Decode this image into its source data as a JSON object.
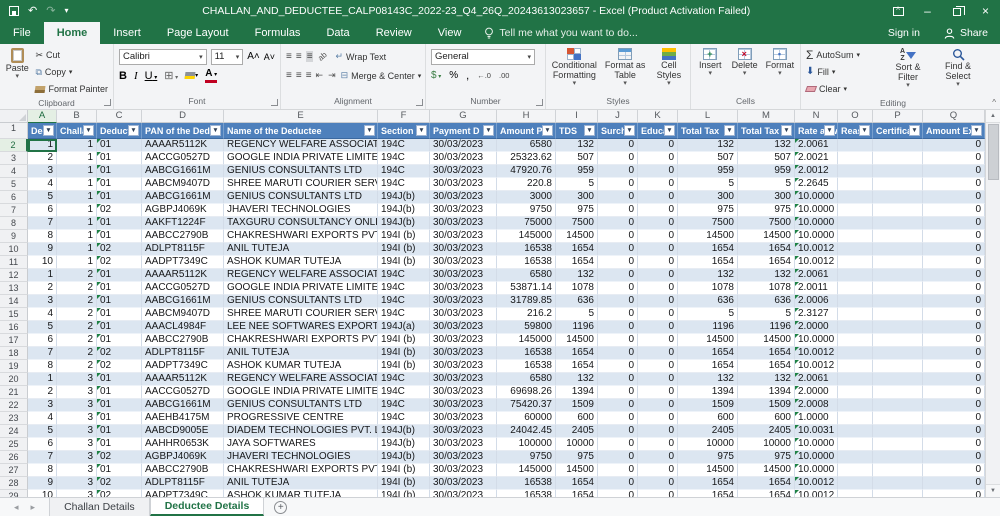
{
  "colors": {
    "excel_green": "#217346",
    "table_header_blue": "#4e80bc",
    "band_blue": "#dce6f1",
    "error_triangle_green": "#1e8245"
  },
  "title_bar": {
    "title": "CHALLAN_AND_DEDUCTEE_CALP08143C_2022-23_Q4_26Q_20243613023657 - Excel (Product Activation Failed)"
  },
  "menu": {
    "tabs": [
      "File",
      "Home",
      "Insert",
      "Page Layout",
      "Formulas",
      "Data",
      "Review",
      "View"
    ],
    "active_tab": "Home",
    "tell_me": "Tell me what you want to do...",
    "sign_in": "Sign in",
    "share": "Share"
  },
  "ribbon": {
    "clipboard": {
      "label": "Clipboard",
      "paste": "Paste",
      "cut": "Cut",
      "copy": "Copy",
      "format_painter": "Format Painter"
    },
    "font": {
      "label": "Font",
      "family": "Calibri",
      "size": "11",
      "bold": "B",
      "italic": "I",
      "underline": "U"
    },
    "alignment": {
      "label": "Alignment",
      "wrap_text": "Wrap Text",
      "merge_center": "Merge & Center"
    },
    "number": {
      "label": "Number",
      "format": "General",
      "percent": "%",
      "comma": ",",
      "inc_dec": "←.0",
      "dec_dec": ".00"
    },
    "styles": {
      "label": "Styles",
      "conditional": "Conditional Formatting",
      "format_table": "Format as Table",
      "cell_styles": "Cell Styles"
    },
    "cells": {
      "label": "Cells",
      "insert": "Insert",
      "delete": "Delete",
      "format": "Format"
    },
    "editing": {
      "label": "Editing",
      "autosum": "AutoSum",
      "fill": "Fill",
      "clear": "Clear",
      "sort_filter": "Sort & Filter",
      "find_select": "Find & Select"
    }
  },
  "icons": {
    "dropdown_arrow": "▾",
    "sigma": "Σ",
    "scissors": "✂",
    "copy": "⧉",
    "bulb": "☼",
    "collapse": "^"
  },
  "grid": {
    "first_row_number": 1,
    "first_data_row_number": 2,
    "active_cell": "A2",
    "columns": [
      {
        "letter": "A",
        "width": 29,
        "header": "Dedu",
        "align": "r",
        "flag": false
      },
      {
        "letter": "B",
        "width": 40,
        "header": "Challan",
        "align": "r",
        "flag": false
      },
      {
        "letter": "C",
        "width": 45,
        "header": "Deducte",
        "align": "l",
        "flag": true
      },
      {
        "letter": "D",
        "width": 82,
        "header": "PAN of the Ded",
        "align": "l",
        "flag": false
      },
      {
        "letter": "E",
        "width": 154,
        "header": "Name of the Deductee",
        "align": "l",
        "flag": false
      },
      {
        "letter": "F",
        "width": 52,
        "header": "Section C",
        "align": "l",
        "flag": false
      },
      {
        "letter": "G",
        "width": 67,
        "header": "Payment D",
        "align": "l",
        "flag": false
      },
      {
        "letter": "H",
        "width": 59,
        "header": "Amount Pa",
        "align": "r",
        "flag": false
      },
      {
        "letter": "I",
        "width": 42,
        "header": "TDS",
        "align": "r",
        "flag": false
      },
      {
        "letter": "J",
        "width": 40,
        "header": "Surchar",
        "align": "r",
        "flag": false
      },
      {
        "letter": "K",
        "width": 40,
        "header": "Educati",
        "align": "r",
        "flag": false
      },
      {
        "letter": "L",
        "width": 60,
        "header": "Total Tax",
        "align": "r",
        "flag": false
      },
      {
        "letter": "M",
        "width": 57,
        "header": "Total Tax",
        "align": "r",
        "flag": false
      },
      {
        "letter": "N",
        "width": 43,
        "header": "Rate at w",
        "align": "l",
        "flag": true
      },
      {
        "letter": "O",
        "width": 35,
        "header": "Reaso",
        "align": "l",
        "flag": false
      },
      {
        "letter": "P",
        "width": 50,
        "header": "Certificat",
        "align": "l",
        "flag": false
      },
      {
        "letter": "Q",
        "width": 62,
        "header": "Amount Ex",
        "align": "r",
        "flag": false
      }
    ],
    "rows": [
      [
        "1",
        "1",
        "01",
        "AAAAR5112K",
        "REGENCY WELFARE ASSOCIATION",
        "194C",
        "30/03/2023",
        "6580",
        "132",
        "0",
        "0",
        "132",
        "132",
        "2.0061",
        "",
        "",
        "0"
      ],
      [
        "2",
        "1",
        "01",
        "AACCG0527D",
        "GOOGLE INDIA PRIVATE LIMITED",
        "194C",
        "30/03/2023",
        "25323.62",
        "507",
        "0",
        "0",
        "507",
        "507",
        "2.0021",
        "",
        "",
        "0"
      ],
      [
        "3",
        "1",
        "01",
        "AABCG1661M",
        "GENIUS CONSULTANTS LTD",
        "194C",
        "30/03/2023",
        "47920.76",
        "959",
        "0",
        "0",
        "959",
        "959",
        "2.0012",
        "",
        "",
        "0"
      ],
      [
        "4",
        "1",
        "01",
        "AABCM9407D",
        "SHREE MARUTI COURIER SERVICES PVT",
        "194C",
        "30/03/2023",
        "220.8",
        "5",
        "0",
        "0",
        "5",
        "5",
        "2.2645",
        "",
        "",
        "0"
      ],
      [
        "5",
        "1",
        "01",
        "AABCG1661M",
        "GENIUS CONSULTANTS LTD",
        "194J(b)",
        "30/03/2023",
        "3000",
        "300",
        "0",
        "0",
        "300",
        "300",
        "10.0000",
        "",
        "",
        "0"
      ],
      [
        "6",
        "1",
        "02",
        "AGBPJ4069K",
        "JHAVERI TECHNOLOGIES",
        "194J(b)",
        "30/03/2023",
        "9750",
        "975",
        "0",
        "0",
        "975",
        "975",
        "10.0000",
        "",
        "",
        "0"
      ],
      [
        "7",
        "1",
        "01",
        "AAKFT1224F",
        "TAXGURU CONSULTANCY  ONLINE PUBL",
        "194J(b)",
        "30/03/2023",
        "75000",
        "7500",
        "0",
        "0",
        "7500",
        "7500",
        "10.0000",
        "",
        "",
        "0"
      ],
      [
        "8",
        "1",
        "01",
        "AABCC2790B",
        "CHAKRESHWARI EXPORTS PVT. LTD.",
        "194I (b)",
        "30/03/2023",
        "145000",
        "14500",
        "0",
        "0",
        "14500",
        "14500",
        "10.0000",
        "",
        "",
        "0"
      ],
      [
        "9",
        "1",
        "02",
        "ADLPT8115F",
        "ANIL TUTEJA",
        "194I (b)",
        "30/03/2023",
        "16538",
        "1654",
        "0",
        "0",
        "1654",
        "1654",
        "10.0012",
        "",
        "",
        "0"
      ],
      [
        "10",
        "1",
        "02",
        "AADPT7349C",
        "ASHOK KUMAR TUTEJA",
        "194I (b)",
        "30/03/2023",
        "16538",
        "1654",
        "0",
        "0",
        "1654",
        "1654",
        "10.0012",
        "",
        "",
        "0"
      ],
      [
        "1",
        "2",
        "01",
        "AAAAR5112K",
        "REGENCY WELFARE ASSOCIATION",
        "194C",
        "30/03/2023",
        "6580",
        "132",
        "0",
        "0",
        "132",
        "132",
        "2.0061",
        "",
        "",
        "0"
      ],
      [
        "2",
        "2",
        "01",
        "AACCG0527D",
        "GOOGLE INDIA PRIVATE LIMITED",
        "194C",
        "30/03/2023",
        "53871.14",
        "1078",
        "0",
        "0",
        "1078",
        "1078",
        "2.0011",
        "",
        "",
        "0"
      ],
      [
        "3",
        "2",
        "01",
        "AABCG1661M",
        "GENIUS CONSULTANTS LTD",
        "194C",
        "30/03/2023",
        "31789.85",
        "636",
        "0",
        "0",
        "636",
        "636",
        "2.0006",
        "",
        "",
        "0"
      ],
      [
        "4",
        "2",
        "01",
        "AABCM9407D",
        "SHREE MARUTI COURIER SERVICES PVT",
        "194C",
        "30/03/2023",
        "216.2",
        "5",
        "0",
        "0",
        "5",
        "5",
        "2.3127",
        "",
        "",
        "0"
      ],
      [
        "5",
        "2",
        "01",
        "AAACL4984F",
        "LEE  NEE SOFTWARES  EXPORTS LTD.",
        "194J(a)",
        "30/03/2023",
        "59800",
        "1196",
        "0",
        "0",
        "1196",
        "1196",
        "2.0000",
        "",
        "",
        "0"
      ],
      [
        "6",
        "2",
        "01",
        "AABCC2790B",
        "CHAKRESHWARI EXPORTS PVT. LTD.",
        "194I (b)",
        "30/03/2023",
        "145000",
        "14500",
        "0",
        "0",
        "14500",
        "14500",
        "10.0000",
        "",
        "",
        "0"
      ],
      [
        "7",
        "2",
        "02",
        "ADLPT8115F",
        "ANIL TUTEJA",
        "194I (b)",
        "30/03/2023",
        "16538",
        "1654",
        "0",
        "0",
        "1654",
        "1654",
        "10.0012",
        "",
        "",
        "0"
      ],
      [
        "8",
        "2",
        "02",
        "AADPT7349C",
        "ASHOK KUMAR TUTEJA",
        "194I (b)",
        "30/03/2023",
        "16538",
        "1654",
        "0",
        "0",
        "1654",
        "1654",
        "10.0012",
        "",
        "",
        "0"
      ],
      [
        "1",
        "3",
        "01",
        "AAAAR5112K",
        "REGENCY WELFARE ASSOCIATION",
        "194C",
        "30/03/2023",
        "6580",
        "132",
        "0",
        "0",
        "132",
        "132",
        "2.0061",
        "",
        "",
        "0"
      ],
      [
        "2",
        "3",
        "01",
        "AACCG0527D",
        "GOOGLE INDIA PRIVATE LIMITED",
        "194C",
        "30/03/2023",
        "69698.26",
        "1394",
        "0",
        "0",
        "1394",
        "1394",
        "2.0000",
        "",
        "",
        "0"
      ],
      [
        "3",
        "3",
        "01",
        "AABCG1661M",
        "GENIUS CONSULTANTS LTD",
        "194C",
        "30/03/2023",
        "75420.37",
        "1509",
        "0",
        "0",
        "1509",
        "1509",
        "2.0008",
        "",
        "",
        "0"
      ],
      [
        "4",
        "3",
        "01",
        "AAEHB4175M",
        "PROGRESSIVE CENTRE",
        "194C",
        "30/03/2023",
        "60000",
        "600",
        "0",
        "0",
        "600",
        "600",
        "1.0000",
        "",
        "",
        "0"
      ],
      [
        "5",
        "3",
        "01",
        "AABCD9005E",
        "DIADEM TECHNOLOGIES PVT. LTD.",
        "194J(b)",
        "30/03/2023",
        "24042.45",
        "2405",
        "0",
        "0",
        "2405",
        "2405",
        "10.0031",
        "",
        "",
        "0"
      ],
      [
        "6",
        "3",
        "01",
        "AAHHR0653K",
        "JAYA SOFTWARES",
        "194J(b)",
        "30/03/2023",
        "100000",
        "10000",
        "0",
        "0",
        "10000",
        "10000",
        "10.0000",
        "",
        "",
        "0"
      ],
      [
        "7",
        "3",
        "02",
        "AGBPJ4069K",
        "JHAVERI TECHNOLOGIES",
        "194J(b)",
        "30/03/2023",
        "9750",
        "975",
        "0",
        "0",
        "975",
        "975",
        "10.0000",
        "",
        "",
        "0"
      ],
      [
        "8",
        "3",
        "01",
        "AABCC2790B",
        "CHAKRESHWARI EXPORTS PVT. LTD.",
        "194I (b)",
        "30/03/2023",
        "145000",
        "14500",
        "0",
        "0",
        "14500",
        "14500",
        "10.0000",
        "",
        "",
        "0"
      ],
      [
        "9",
        "3",
        "02",
        "ADLPT8115F",
        "ANIL TUTEJA",
        "194I (b)",
        "30/03/2023",
        "16538",
        "1654",
        "0",
        "0",
        "1654",
        "1654",
        "10.0012",
        "",
        "",
        "0"
      ],
      [
        "10",
        "3",
        "02",
        "AADPT7349C",
        "ASHOK KUMAR TUTEJA",
        "194I (b)",
        "30/03/2023",
        "16538",
        "1654",
        "0",
        "0",
        "1654",
        "1654",
        "10.0012",
        "",
        "",
        "0"
      ]
    ]
  },
  "tabs": {
    "sheets": [
      "Challan Details",
      "Deductee Details"
    ],
    "active": "Deductee Details"
  }
}
